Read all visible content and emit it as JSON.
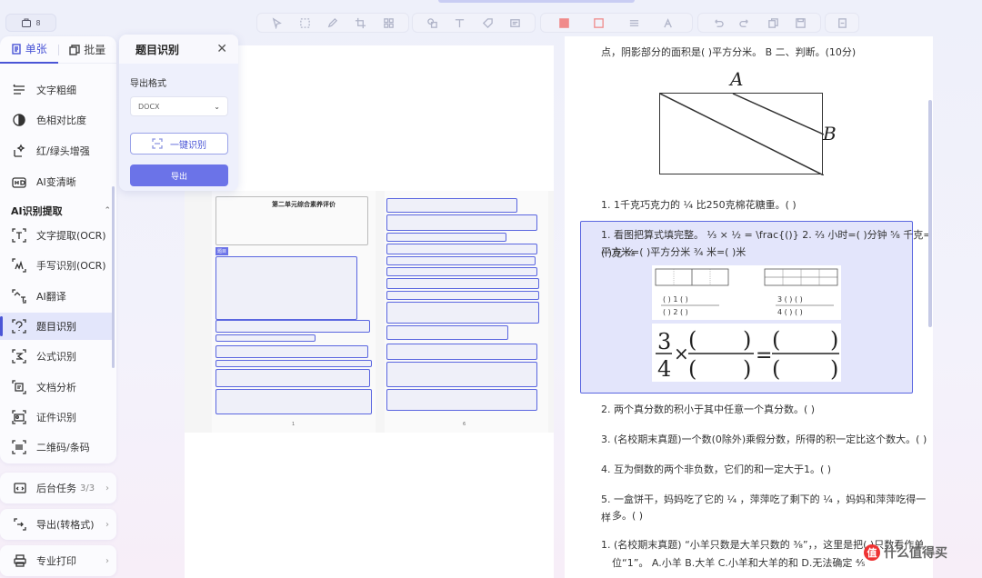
{
  "app": {
    "badge": "8"
  },
  "toolbar": {
    "groups": [
      [
        "cursor-icon",
        "select-icon",
        "pen-icon",
        "crop-icon",
        "mosaic-icon"
      ],
      [
        "shape-icon",
        "text-icon",
        "tag-icon",
        "note-icon"
      ],
      [
        "fill-red-icon",
        "stroke-red-icon",
        "line-width-icon",
        "font-size-icon"
      ],
      [
        "undo-icon",
        "redo-icon",
        "copy-icon",
        "save-icon"
      ],
      [
        "export-icon"
      ]
    ]
  },
  "sidebar": {
    "tabs": [
      {
        "label": "单张",
        "active": true
      },
      {
        "label": "批量",
        "active": false
      }
    ],
    "items": [
      {
        "label": "文字粗细",
        "icon": "text-weight-icon"
      },
      {
        "label": "色相对比度",
        "icon": "contrast-icon"
      },
      {
        "label": "红/绿头增强",
        "icon": "sparkle-icon"
      },
      {
        "label": "AI变清晰",
        "icon": "hd-icon"
      }
    ],
    "section_title": "AI识别提取",
    "section_items": [
      {
        "label": "文字提取(OCR)",
        "icon": "ocr-icon"
      },
      {
        "label": "手写识别(OCR)",
        "icon": "handwriting-icon"
      },
      {
        "label": "AI翻译",
        "icon": "translate-icon"
      },
      {
        "label": "题目识别",
        "icon": "question-scan-icon",
        "active": true
      },
      {
        "label": "公式识别",
        "icon": "formula-icon"
      },
      {
        "label": "文档分析",
        "icon": "doc-analysis-icon"
      },
      {
        "label": "证件识别",
        "icon": "id-card-icon"
      },
      {
        "label": "二维码/条码",
        "icon": "qrcode-icon"
      }
    ],
    "cards": [
      {
        "label": "后台任务",
        "count": "3/3",
        "icon": "task-icon"
      },
      {
        "label": "导出(转格式)",
        "icon": "export-format-icon"
      },
      {
        "label": "专业打印",
        "icon": "print-icon"
      }
    ]
  },
  "panel": {
    "title": "题目识别",
    "format_label": "导出格式",
    "format_value": "DOCX",
    "recognize_label": "一键识别",
    "export_label": "导出"
  },
  "scan": {
    "title": "第二单元综合素养评价",
    "tag": "题目",
    "footer_left": "1",
    "footer_right": "6"
  },
  "right_page": {
    "q0": "点，阴影部分的面积是( )平方分米。 B 二、判断。(10分)",
    "fig_a": "A",
    "fig_b": "B",
    "q1": "1. 1千克巧克力的 ¼ 比250克棉花糖重。( )",
    "q2_line1": "1. 看图把算式填完整。 ⅓ × ½ = \\frac{()} 2. ⅔ 小时=( )分钟 ⅝ 千克=( )克 ⁷⁄₈",
    "q2_line2": "平方米=( )平方分米 ¾ 米=( )米",
    "frac_left": "3",
    "frac_den": "4",
    "q3": "2. 两个真分数的积小于其中任意一个真分数。( )",
    "q4": "3. (名校期末真题)一个数(0除外)乘假分数，所得的积一定比这个数大。( )",
    "q5": "4. 互为倒数的两个非负数，它们的和一定大于1。( )",
    "q6_line1": "5. 一盒饼干，妈妈吃了它的 ¼ ，萍萍吃了剩下的 ¼ ，妈妈和萍萍吃得一样",
    "q6_line2": "多。( )",
    "q7_line1": "1. (名校期末真题) “小羊只数是大羊只数的 ³⁄₈”，，这里是把( )只数看作单",
    "q7_line2": "位“1”。 A.小羊 B.大羊 C.小羊和大羊的和 D.无法确定 ⁴⁄₅"
  },
  "watermark": {
    "text": "什么值得买",
    "badge": "值"
  }
}
